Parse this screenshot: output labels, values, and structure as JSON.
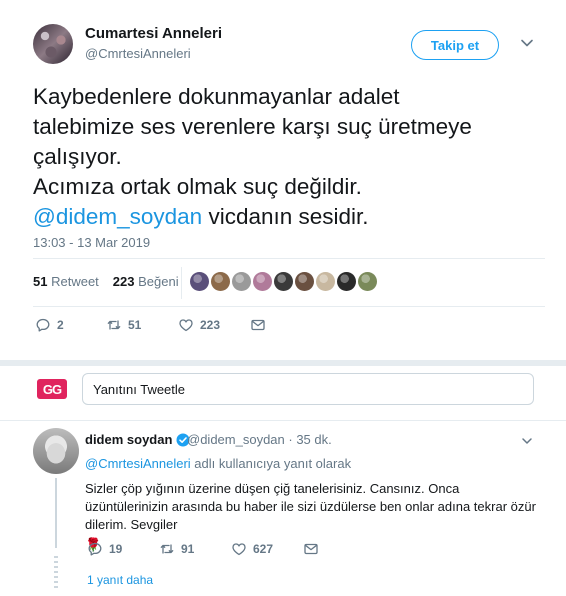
{
  "tweet": {
    "display_name": "Cumartesi Anneleri",
    "handle": "@CmrtesiAnneleri",
    "follow_label": "Takip et",
    "text_lines": [
      "Kaybedenlere dokunmayanlar adalet",
      "talebimize ses verenlere karşı suç üretmeye",
      "çalışıyor.",
      "Acımıza ortak olmak suç değildir."
    ],
    "mention": "@didem_soydan",
    "mention_suffix": " vicdanın sesidir.",
    "timestamp": "13:03 - 13 Mar 2019",
    "retweet_count": "51",
    "retweet_label": "Retweet",
    "like_count": "223",
    "like_label": "Beğeni",
    "liker_colors": [
      "#5a4f7a",
      "#8c6a4a",
      "#9a9a9a",
      "#b07a9a",
      "#3a3a3a",
      "#6a5040",
      "#c8b8a0",
      "#2a2a2a",
      "#7a8a5a"
    ],
    "actions": {
      "reply_count": "2",
      "retweet_count": "51",
      "like_count": "223"
    }
  },
  "reply_box": {
    "logo_text": "GG",
    "placeholder": "Yanıtını Tweetle"
  },
  "reply": {
    "display_name": "didem soydan",
    "handle": "@didem_soydan",
    "age": "· 35 dk.",
    "replying_link": "@CmrtesiAnneleri",
    "replying_suffix": " adlı kullanıcıya yanıt olarak",
    "text": "Sizler çöp yığının üzerine düşen çiğ tanelerisiniz. Cansınız. Onca üzüntülerinizin arasında bu haber ile sizi üzdülerse ben onlar adına  tekrar özür dilerim. Sevgiler",
    "emoji": "🌹",
    "reply_count": "19",
    "retweet_count": "91",
    "like_count": "627",
    "more_replies": "1 yanıt daha"
  },
  "colors": {
    "accent": "#1da1f2",
    "link": "#1b95e0",
    "muted": "#657786",
    "text": "#14171a",
    "divider": "#e6ecf0"
  }
}
